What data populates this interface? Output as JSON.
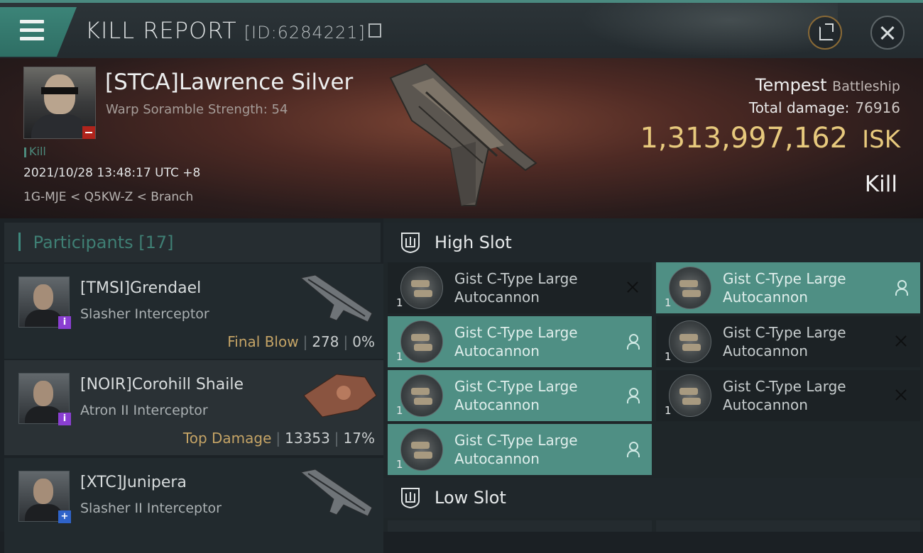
{
  "header": {
    "title": "KILL REPORT",
    "report_id": "[ID:6284221]"
  },
  "victim": {
    "name": "[STCA]Lawrence Silver",
    "subtitle": "Warp Soramble Strength: 54",
    "tag": "Kill",
    "datetime": "2021/10/28 13:48:17 UTC +8",
    "location": "1G-MJE < Q5KW-Z < Branch",
    "ship": "Tempest",
    "ship_class": "Battleship",
    "total_damage_label": "Total damage:",
    "total_damage": "76916",
    "isk_value": "1,313,997,162",
    "isk_unit": "ISK",
    "result": "Kill"
  },
  "participants": {
    "label": "Participants",
    "count": "[17]",
    "items": [
      {
        "name": "[TMSI]Grendael",
        "ship": "Slasher Interceptor",
        "tag": "Final Blow",
        "damage": "278",
        "percent": "0%",
        "badge": "i",
        "badge_color": "#8a3fd1"
      },
      {
        "name": "[NOIR]Corohill Shaile",
        "ship": "Atron II Interceptor",
        "tag": "Top Damage",
        "damage": "13353",
        "percent": "17%",
        "badge": "i",
        "badge_color": "#8a3fd1"
      },
      {
        "name": "[XTC]Junipera",
        "ship": "Slasher II Interceptor",
        "tag": "",
        "damage": "",
        "percent": "",
        "badge": "+",
        "badge_color": "#2f63c9"
      }
    ]
  },
  "slots": {
    "high_label": "High Slot",
    "low_label": "Low Slot",
    "high": [
      {
        "line1": "Gist C-Type Large",
        "line2": "Autocannon",
        "qty": "1",
        "state": "destroyed"
      },
      {
        "line1": "Gist C-Type Large",
        "line2": "Autocannon",
        "qty": "1",
        "state": "dropped"
      },
      {
        "line1": "Gist C-Type Large",
        "line2": "Autocannon",
        "qty": "1",
        "state": "dropped"
      },
      {
        "line1": "Gist C-Type Large",
        "line2": "Autocannon",
        "qty": "1",
        "state": "destroyed"
      },
      {
        "line1": "Gist C-Type Large",
        "line2": "Autocannon",
        "qty": "1",
        "state": "dropped"
      },
      {
        "line1": "Gist C-Type Large",
        "line2": "Autocannon",
        "qty": "1",
        "state": "destroyed"
      },
      {
        "line1": "Gist C-Type Large",
        "line2": "Autocannon",
        "qty": "1",
        "state": "dropped"
      }
    ]
  },
  "colors": {
    "accent": "#4f8f84",
    "isk": "#e7c97d",
    "tag_gold": "#c5a466"
  }
}
